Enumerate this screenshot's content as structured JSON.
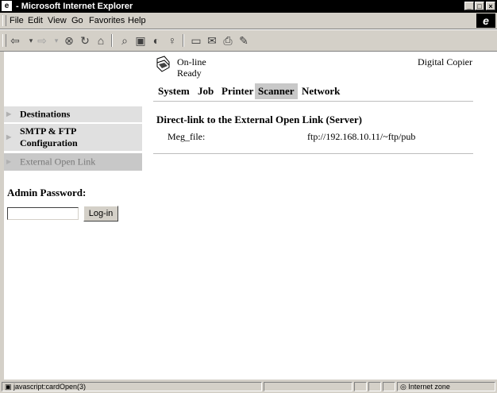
{
  "window": {
    "title": " - Microsoft Internet Explorer",
    "app_icon": "ie-icon",
    "controls": [
      "minimize",
      "maximize",
      "close"
    ]
  },
  "menubar": {
    "items": [
      "File",
      "Edit",
      "View",
      "Go",
      "Favorites",
      "Help"
    ]
  },
  "toolbar": {
    "buttons": [
      "back-icon",
      "forward-icon",
      "stop-icon",
      "refresh-icon",
      "home-icon",
      "search-icon",
      "favorites-icon",
      "history-icon",
      "channels-icon",
      "fullscreen-icon",
      "mail-icon",
      "print-icon",
      "edit-icon"
    ]
  },
  "page": {
    "status_line1": "On-line",
    "status_line2": "Ready",
    "device_name": "Digital Copier",
    "tabs": [
      {
        "label": "System",
        "active": false
      },
      {
        "label": "Job",
        "active": false
      },
      {
        "label": "Printer",
        "active": false
      },
      {
        "label": "Scanner",
        "active": true
      },
      {
        "label": "Network",
        "active": false
      }
    ],
    "sidebar": {
      "items": [
        {
          "label": "Destinations",
          "active": false
        },
        {
          "label": "SMTP & FTP\nConfiguration",
          "active": false
        },
        {
          "label": "External Open Link",
          "active": true
        }
      ],
      "admin_label": "Admin Password:",
      "password_value": "",
      "login_label": "Log-in"
    },
    "main": {
      "section_title": "Direct-link to the External Open Link (Server)",
      "field_label": "Meg_file:",
      "field_value": "ftp://192.168.10.11/~ftp/pub"
    }
  },
  "statusbar": {
    "text": "javascript:cardOpen(3)",
    "zone": "Internet zone"
  }
}
